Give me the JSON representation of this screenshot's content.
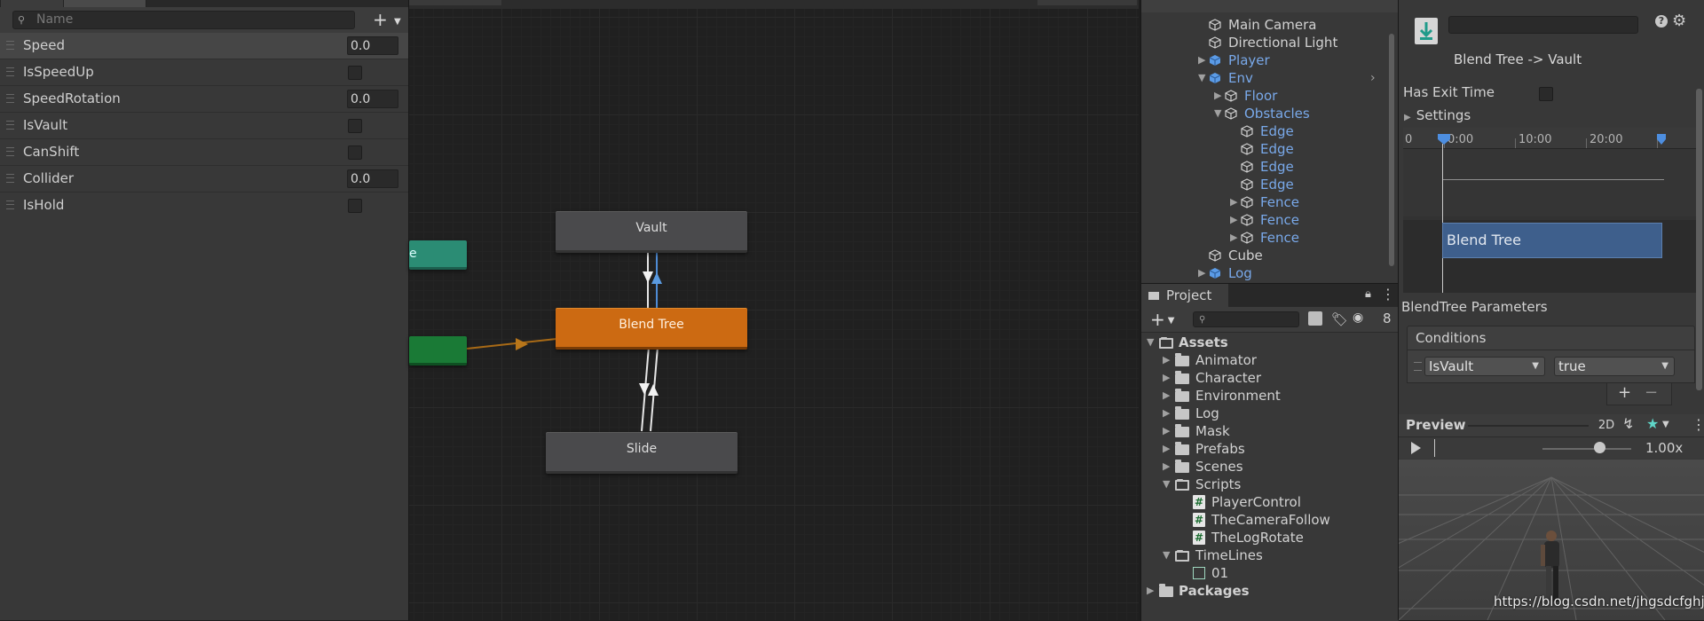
{
  "parameters": {
    "search_placeholder": "Name",
    "items": [
      {
        "name": "Speed",
        "type": "float",
        "value": "0.0"
      },
      {
        "name": "IsSpeedUp",
        "type": "bool"
      },
      {
        "name": "SpeedRotation",
        "type": "float",
        "value": "0.0"
      },
      {
        "name": "IsVault",
        "type": "bool"
      },
      {
        "name": "CanShift",
        "type": "bool"
      },
      {
        "name": "Collider",
        "type": "float",
        "value": "0.0"
      },
      {
        "name": "IsHold",
        "type": "bool"
      }
    ]
  },
  "graph": {
    "nodes": {
      "vault": "Vault",
      "blend_tree": "Blend Tree",
      "slide": "Slide",
      "teal_partial": "e"
    }
  },
  "hierarchy": {
    "items": [
      {
        "label": "Main Camera",
        "color": "white"
      },
      {
        "label": "Directional Light",
        "color": "white"
      },
      {
        "label": "Player",
        "color": "blue"
      },
      {
        "label": "Env",
        "color": "blue"
      },
      {
        "label": "Floor",
        "color": "blue"
      },
      {
        "label": "Obstacles",
        "color": "blue"
      },
      {
        "label": "Edge",
        "color": "blue"
      },
      {
        "label": "Edge",
        "color": "blue"
      },
      {
        "label": "Edge",
        "color": "blue"
      },
      {
        "label": "Edge",
        "color": "blue"
      },
      {
        "label": "Fence",
        "color": "blue"
      },
      {
        "label": "Fence",
        "color": "blue"
      },
      {
        "label": "Fence",
        "color": "blue"
      },
      {
        "label": "Cube",
        "color": "white"
      },
      {
        "label": "Log",
        "color": "blue"
      }
    ]
  },
  "project": {
    "tab_label": "Project",
    "hidden_count": "8",
    "items": [
      "Assets",
      "Animator",
      "Character",
      "Environment",
      "Log",
      "Mask",
      "Prefabs",
      "Scenes",
      "Scripts",
      "PlayerControl",
      "TheCameraFollow",
      "TheLogRotate",
      "TimeLines",
      "01",
      "Packages"
    ]
  },
  "inspector": {
    "transition_title": "Blend Tree -> Vault",
    "help_label": "?",
    "has_exit_time_label": "Has Exit Time",
    "settings_label": "Settings",
    "timeline": {
      "ticks": [
        "0",
        "0:00",
        "10:00",
        "20:00"
      ],
      "bar_label": "Blend Tree"
    },
    "blendtree_params_label": "BlendTree Parameters",
    "conditions_label": "Conditions",
    "condition": {
      "param": "IsVault",
      "value": "true"
    },
    "add_label": "+",
    "remove_label": "−"
  },
  "preview": {
    "title": "Preview",
    "mode_2d": "2D",
    "speed": "1.00x"
  },
  "watermark": "https://blog.csdn.net/jhgsdcfghjkl",
  "colors": {
    "accent_orange": "#cc6a12",
    "teal": "#2b8c74",
    "green": "#1a7a36",
    "link_blue": "#79a9ea",
    "timeline_bar": "#3e5f8c"
  }
}
